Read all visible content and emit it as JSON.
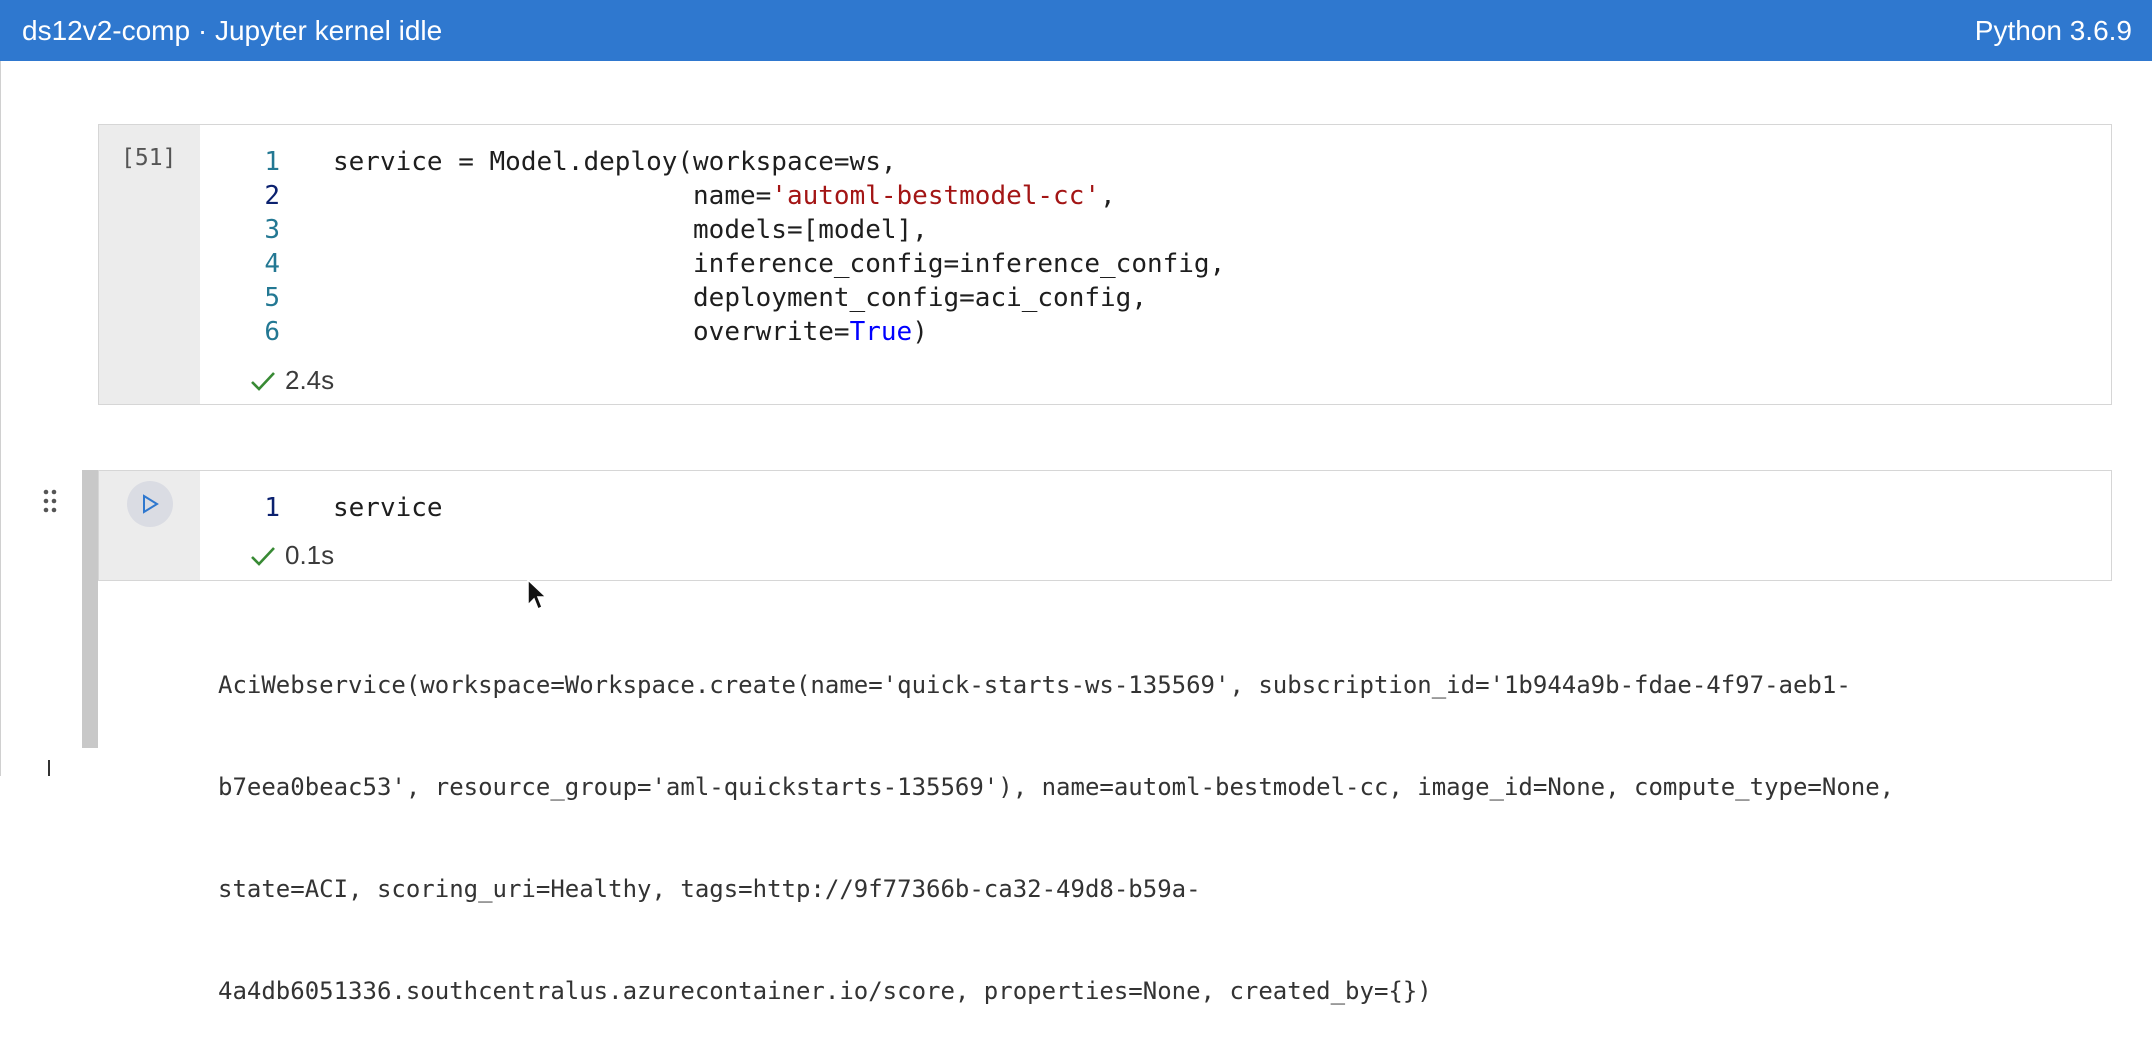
{
  "topbar": {
    "kernel_status": "ds12v2-comp · Jupyter kernel idle",
    "python_version": "Python 3.6.9",
    "background": "#2f78cf"
  },
  "cells": [
    {
      "execution_count": "[51]",
      "lines": [
        {
          "n": "1",
          "code": "service = Model.deploy(workspace=ws,"
        },
        {
          "n": "2",
          "code": "                       name=",
          "str": "'automl-bestmodel-cc'",
          "tail": ","
        },
        {
          "n": "3",
          "code": "                       models=[model],"
        },
        {
          "n": "4",
          "code": "                       inference_config=inference_config,"
        },
        {
          "n": "5",
          "code": "                       deployment_config=aci_config,"
        },
        {
          "n": "6",
          "code": "                       overwrite=",
          "kw": "True",
          "tail": ")"
        }
      ],
      "duration": "2.4s"
    },
    {
      "lines": [
        {
          "n": "1",
          "code": "service"
        }
      ],
      "duration": "0.1s",
      "output": [
        "AciWebservice(workspace=Workspace.create(name='quick-starts-ws-135569', subscription_id='1b944a9b-fdae-4f97-aeb1-",
        "b7eea0beac53', resource_group='aml-quickstarts-135569'), name=automl-bestmodel-cc, image_id=None, compute_type=None,",
        "state=ACI, scoring_uri=Healthy, tags=http://9f77366b-ca32-49d8-b59a-",
        "4a4db6051336.southcentralus.azurecontainer.io/score, properties=None, created_by={})"
      ]
    }
  ],
  "icons": {
    "check": "check-icon",
    "run": "run-icon",
    "drag": "drag-handle-icon",
    "cursor": "mouse-cursor-icon"
  },
  "colors": {
    "string": "#a31515",
    "keyword": "#0000ff",
    "line_number": "#237893",
    "success": "#388a34"
  }
}
